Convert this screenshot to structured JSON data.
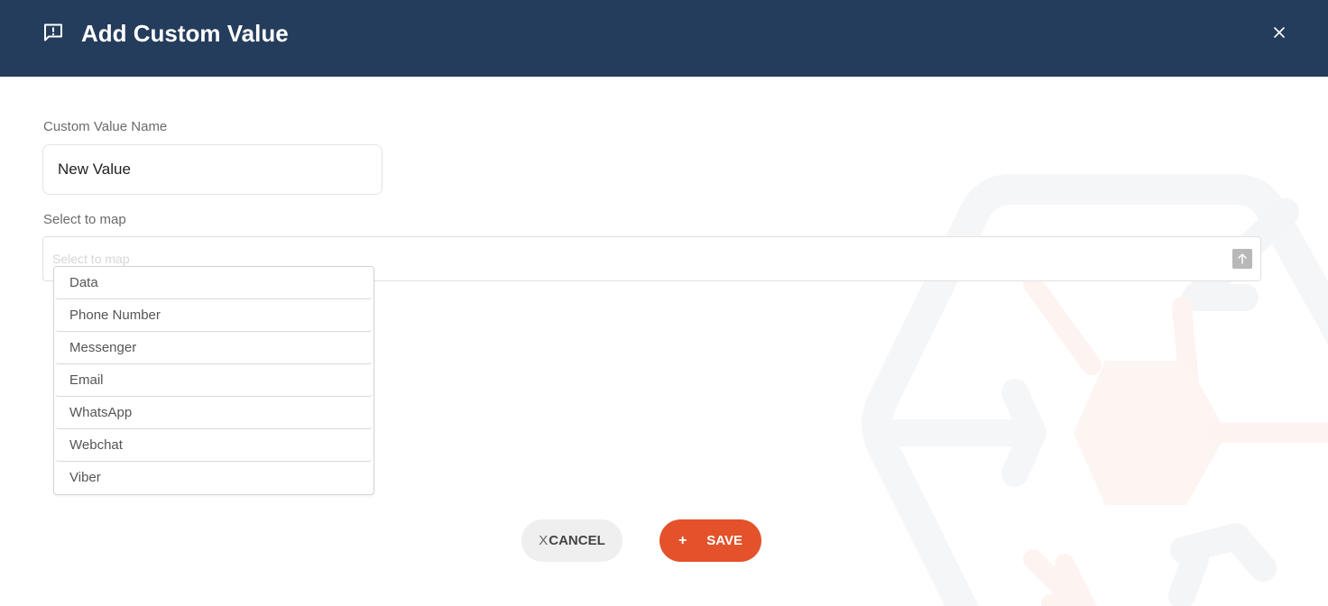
{
  "dialog": {
    "title": "Add Custom Value",
    "header_icon": "report-feedback-icon",
    "close_icon": "close-icon"
  },
  "form": {
    "name_label": "Custom Value Name",
    "name_value": "New Value",
    "map_label": "Select to map",
    "map_placeholder": "Select to map",
    "map_toggle_icon": "arrow-up-icon",
    "options": [
      {
        "label": "Data"
      },
      {
        "label": "Phone Number"
      },
      {
        "label": "Messenger"
      },
      {
        "label": "Email"
      },
      {
        "label": "WhatsApp"
      },
      {
        "label": "Webchat"
      },
      {
        "label": "Viber"
      }
    ]
  },
  "actions": {
    "cancel_prefix": "X",
    "cancel_label": "CANCEL",
    "save_icon": "+",
    "save_label": "SAVE"
  },
  "colors": {
    "header_bg": "#253d5c",
    "save_bg": "#e3522a",
    "cancel_bg": "#efefef"
  }
}
